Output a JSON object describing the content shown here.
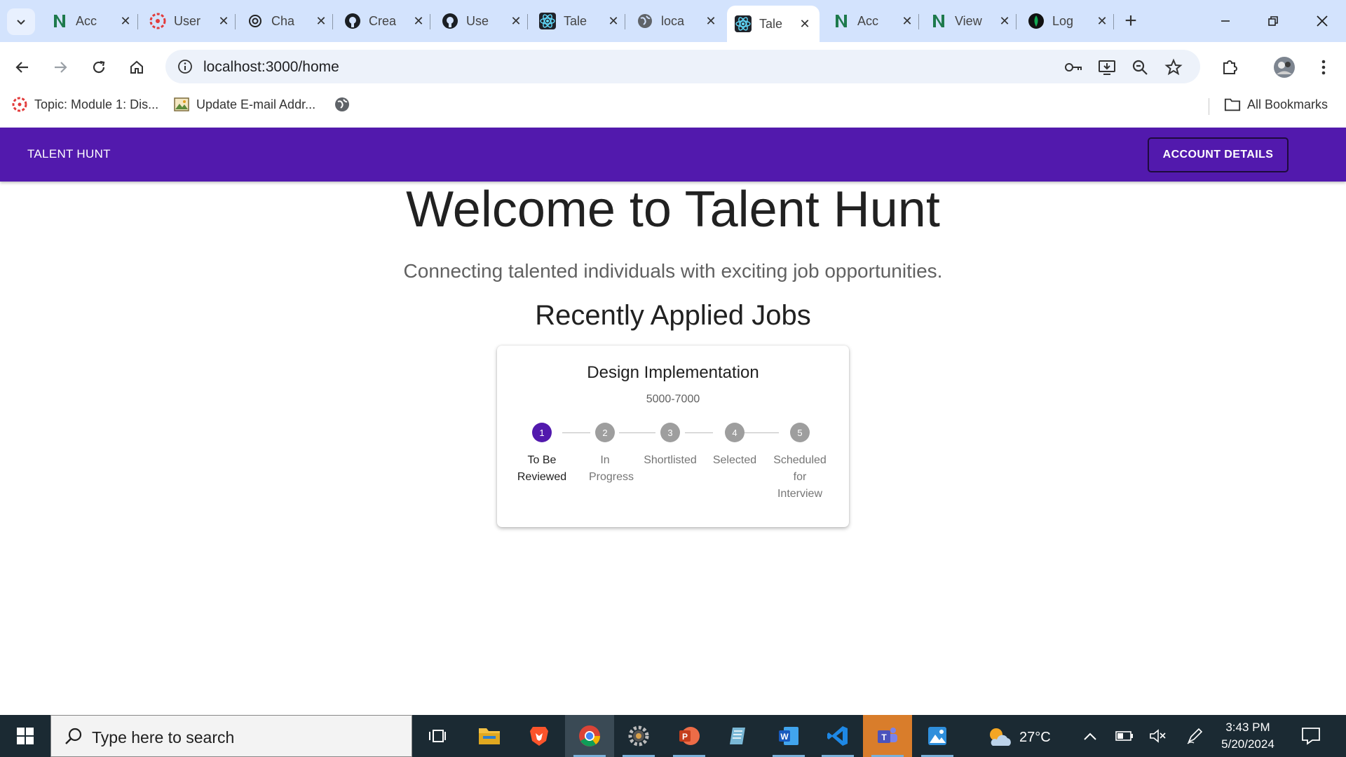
{
  "browser": {
    "tabs": [
      {
        "title": "Acc",
        "icon": "notion-n-icon"
      },
      {
        "title": "User",
        "icon": "canvas-icon"
      },
      {
        "title": "Cha",
        "icon": "openai-icon"
      },
      {
        "title": "Crea",
        "icon": "github-icon"
      },
      {
        "title": "Use",
        "icon": "github-icon"
      },
      {
        "title": "Tale",
        "icon": "react-icon"
      },
      {
        "title": "loca",
        "icon": "globe-icon"
      },
      {
        "title": "Tale",
        "icon": "react-icon",
        "active": true
      },
      {
        "title": "Acc",
        "icon": "notion-n-icon"
      },
      {
        "title": "View",
        "icon": "notion-n-icon"
      },
      {
        "title": "Log",
        "icon": "mongodb-leaf-icon"
      }
    ],
    "url": "localhost:3000/home",
    "bookmarks": [
      {
        "label": "Topic: Module 1: Dis...",
        "icon": "canvas-icon"
      },
      {
        "label": "Update E-mail Addr...",
        "icon": "image-icon"
      }
    ],
    "all_bookmarks_label": "All Bookmarks"
  },
  "app": {
    "brand": "TALENT HUNT",
    "account_button": "ACCOUNT DETAILS",
    "hero_title": "Welcome to Talent Hunt",
    "hero_subtitle": "Connecting talented individuals with exciting job opportunities.",
    "section_title": "Recently Applied Jobs",
    "primary_color": "#5219ad",
    "job": {
      "title": "Design Implementation",
      "salary": "5000-7000",
      "active_step": 1,
      "steps": [
        {
          "num": "1",
          "label": "To Be Reviewed"
        },
        {
          "num": "2",
          "label": "In Progress"
        },
        {
          "num": "3",
          "label": "Shortlisted"
        },
        {
          "num": "4",
          "label": "Selected"
        },
        {
          "num": "5",
          "label": "Scheduled for Interview"
        }
      ]
    }
  },
  "taskbar": {
    "search_placeholder": "Type here to search",
    "temperature": "27°C",
    "time": "3:43 PM",
    "date": "5/20/2024"
  }
}
